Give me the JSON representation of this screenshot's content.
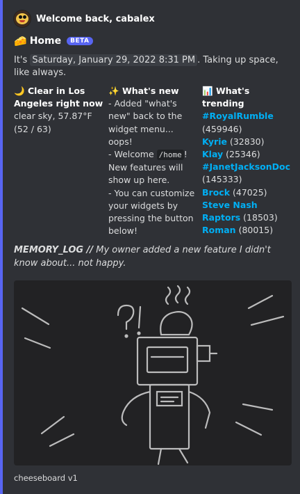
{
  "author": {
    "name": "Welcome back, cabalex",
    "avatar_icon": "cheese-face-avatar"
  },
  "title": {
    "icon": "🧀",
    "text": "Home",
    "badge": "BETA"
  },
  "description": {
    "prefix": "It's ",
    "timestamp": "Saturday, January 29, 2022 8:31 PM",
    "suffix": ". Taking up space, like always."
  },
  "weather": {
    "icon": "🌙",
    "name": "Clear in Los Angeles right now",
    "value": "clear sky, 57.87°F (52 / 63)"
  },
  "whats_new": {
    "icon": "✨",
    "name": "What's new",
    "line1": "- Added \"what's new\" back to the widget menu... oops!",
    "line2_prefix": "- Welcome ",
    "line2_code": "/home",
    "line2_suffix": "! New features will show up here.",
    "line3": "- You can customize your widgets by pressing the button below!"
  },
  "trending": {
    "icon": "📊",
    "name": "What's trending",
    "items": [
      {
        "label": "#RoyalRumble",
        "count": "(459946)"
      },
      {
        "label": "Kyrie",
        "count": "(32830)"
      },
      {
        "label": "Klay",
        "count": "(25346)"
      },
      {
        "label": "#JanetJacksonDoc",
        "count": "(145333)"
      },
      {
        "label": "Brock",
        "count": "(47025)"
      },
      {
        "label": "Steve Nash",
        "count": ""
      },
      {
        "label": "Raptors",
        "count": "(18503)"
      },
      {
        "label": "Roman",
        "count": "(80015)"
      }
    ]
  },
  "memory_log": {
    "label": "MEMORY_LOG //",
    "text": " My owner added a new feature I didn't know about... not happy."
  },
  "image": {
    "subject": "chalk-robot-drawing"
  },
  "footer": {
    "text": "cheeseboard v1"
  },
  "colors": {
    "accent": "#5865f2",
    "link": "#00aff4",
    "background": "#2f3136"
  }
}
